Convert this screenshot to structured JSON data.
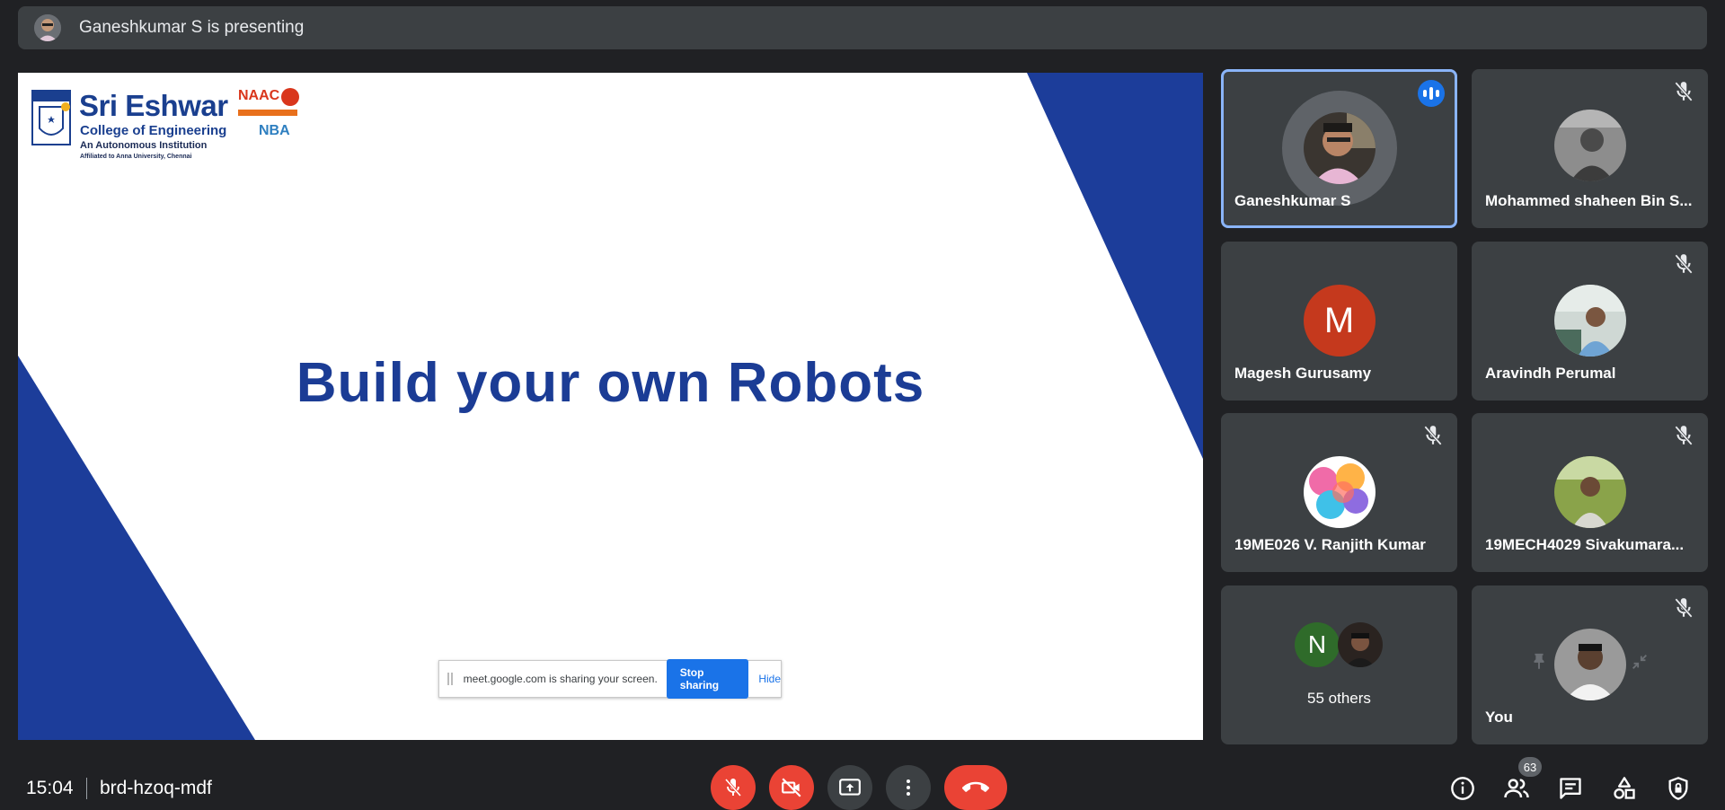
{
  "presenting": {
    "label": "Ganeshkumar S is presenting"
  },
  "slide": {
    "title": "Build your own Robots",
    "logo": {
      "name": "Sri Eshwar",
      "subtitle": "College of Engineering",
      "tagline": "An Autonomous Institution",
      "affiliation": "Affiliated to Anna University, Chennai",
      "naac": "NAAC",
      "nba": "NBA"
    },
    "colors": {
      "accent": "#1b3c95",
      "triangle": "#1c3d9a"
    }
  },
  "share_bar": {
    "message": "meet.google.com is sharing your screen.",
    "stop_label": "Stop sharing",
    "hide_label": "Hide"
  },
  "participants": [
    {
      "name": "Ganeshkumar S",
      "speaking": true,
      "muted": false,
      "avatar": "photo"
    },
    {
      "name": "Mohammed shaheen Bin S...",
      "speaking": false,
      "muted": true,
      "avatar": "photo"
    },
    {
      "name": "Magesh Gurusamy",
      "speaking": false,
      "muted": false,
      "avatar": "letter",
      "letter": "M",
      "color": "#c5391d"
    },
    {
      "name": "Aravindh Perumal",
      "speaking": false,
      "muted": true,
      "avatar": "photo"
    },
    {
      "name": "19ME026 V. Ranjith Kumar",
      "speaking": false,
      "muted": true,
      "avatar": "photo"
    },
    {
      "name": "19MECH4029 Sivakumara...",
      "speaking": false,
      "muted": true,
      "avatar": "photo"
    }
  ],
  "others": {
    "label": "55 others",
    "letter": "N",
    "letter_color": "#2f6b2a"
  },
  "self": {
    "name": "You",
    "muted": true
  },
  "footer": {
    "time": "15:04",
    "meeting_code": "brd-hzoq-mdf",
    "people_count": "63"
  }
}
